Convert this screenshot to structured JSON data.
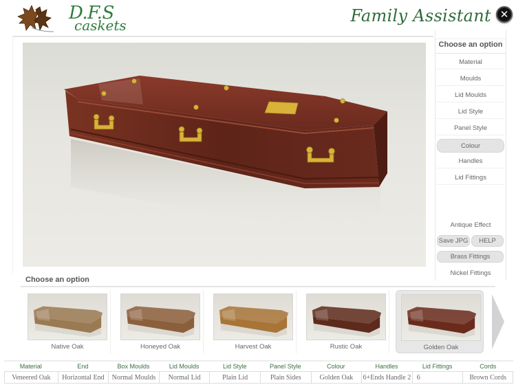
{
  "header": {
    "brand_line1": "D.F.S",
    "brand_line2": "caskets",
    "app_title": "Family Assistant",
    "close_glyph": "✕"
  },
  "colors": {
    "brand_green": "#2e7d3e",
    "selected_bg": "#e4e4e4",
    "casket_wood": "#6e2a1e",
    "brass": "#d9b23a"
  },
  "preview": {
    "current_colour": "Golden Oak",
    "fittings": "Brass"
  },
  "side_panel": {
    "heading": "Choose an option",
    "menu": [
      {
        "label": "Material",
        "selected": false
      },
      {
        "label": "Moulds",
        "selected": false
      },
      {
        "label": "Lid Moulds",
        "selected": false
      },
      {
        "label": "Lid Style",
        "selected": false
      },
      {
        "label": "Panel Style",
        "selected": false
      },
      {
        "label": "Colour",
        "selected": true
      },
      {
        "label": "Handles",
        "selected": false
      },
      {
        "label": "Lid Fittings",
        "selected": false
      }
    ],
    "antique_effect": "Antique Effect",
    "save_jpg": "Save JPG",
    "help": "HELP",
    "brass_fittings": "Brass Fittings",
    "nickel_fittings": "Nickel Fittings"
  },
  "options": {
    "heading": "Choose an option",
    "items": [
      {
        "label": "Native Oak",
        "color": "#9a7a52",
        "selected": false
      },
      {
        "label": "Honeyed Oak",
        "color": "#8c5f3c",
        "selected": false
      },
      {
        "label": "Harvest Oak",
        "color": "#a87438",
        "selected": false
      },
      {
        "label": "Rustic Oak",
        "color": "#5e2a1c",
        "selected": false
      },
      {
        "label": "Golden Oak",
        "color": "#6a2b1d",
        "selected": true
      }
    ],
    "next_icon": "chevron-right"
  },
  "summary": {
    "columns": [
      {
        "header": "Material",
        "value": "Veneered Oak"
      },
      {
        "header": "End",
        "value": "Horizontal End"
      },
      {
        "header": "Box Moulds",
        "value": "Normal Moulds"
      },
      {
        "header": "Lid Moulds",
        "value": "Normal Lid"
      },
      {
        "header": "Lid Style",
        "value": "Plain Lid"
      },
      {
        "header": "Panel Style",
        "value": "Plain Sides"
      },
      {
        "header": "Colour",
        "value": "Golden Oak"
      },
      {
        "header": "Handles",
        "value": "6+Ends Handle 2"
      },
      {
        "header": "Lid Fittings",
        "value": "6"
      },
      {
        "header": "Cords",
        "value": "Brown Cords"
      }
    ]
  }
}
